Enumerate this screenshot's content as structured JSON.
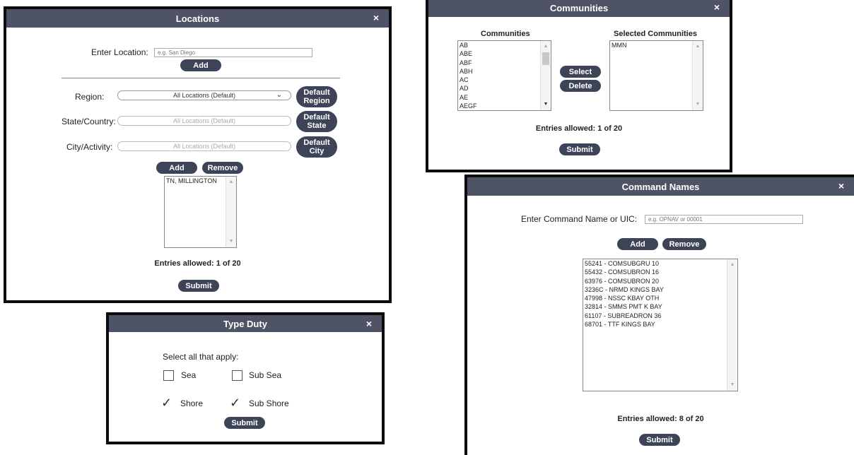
{
  "locations": {
    "title": "Locations",
    "close": "×",
    "enter_label": "Enter Location:",
    "enter_placeholder": "e.g. San Diego",
    "add_label": "Add",
    "region_label": "Region:",
    "region_value": "All Locations (Default)",
    "state_label": "State/Country:",
    "state_value": "All Locations (Default)",
    "city_label": "City/Activity:",
    "city_value": "All Locations (Default)",
    "default_region": "Default Region",
    "default_state": "Default State",
    "default_city": "Default City",
    "add2_label": "Add",
    "remove_label": "Remove",
    "list": [
      "TN, MILLINGTON"
    ],
    "entries": "Entries allowed: 1 of 20",
    "submit": "Submit"
  },
  "communities": {
    "title": "Communities",
    "close": "×",
    "left_header": "Communities",
    "right_header": "Selected Communities",
    "options": [
      "AB",
      "ABE",
      "ABF",
      "ABH",
      "AC",
      "AD",
      "AE",
      "AEGF"
    ],
    "selected": [
      "MMN"
    ],
    "select_label": "Select",
    "delete_label": "Delete",
    "entries": "Entries allowed: 1 of 20",
    "submit": "Submit"
  },
  "command_names": {
    "title": "Command Names",
    "close": "×",
    "enter_label": "Enter Command Name or UIC:",
    "enter_placeholder": "e.g. OPNAV or 00001",
    "add_label": "Add",
    "remove_label": "Remove",
    "list": [
      "55241 - COMSUBGRU 10",
      "55432 - COMSUBRON 16",
      "63976 - COMSUBRON 20",
      "3236C - NRMD KINGS BAY",
      "47998 - NSSC KBAY OTH",
      "32814 - SMMS PMT K BAY",
      "61107 - SUBREADRON 36",
      "68701 - TTF KINGS BAY"
    ],
    "entries": "Entries allowed: 8 of 20",
    "submit": "Submit"
  },
  "type_duty": {
    "title": "Type Duty",
    "close": "×",
    "prompt": "Select all that apply:",
    "options": [
      {
        "label": "Sea",
        "checked": false
      },
      {
        "label": "Sub Sea",
        "checked": false
      },
      {
        "label": "Shore",
        "checked": true
      },
      {
        "label": "Sub Shore",
        "checked": true
      }
    ],
    "submit": "Submit"
  },
  "colors": {
    "titlebar": "#4e5466",
    "button": "#3d4457",
    "frame": "#0c0c0c"
  }
}
